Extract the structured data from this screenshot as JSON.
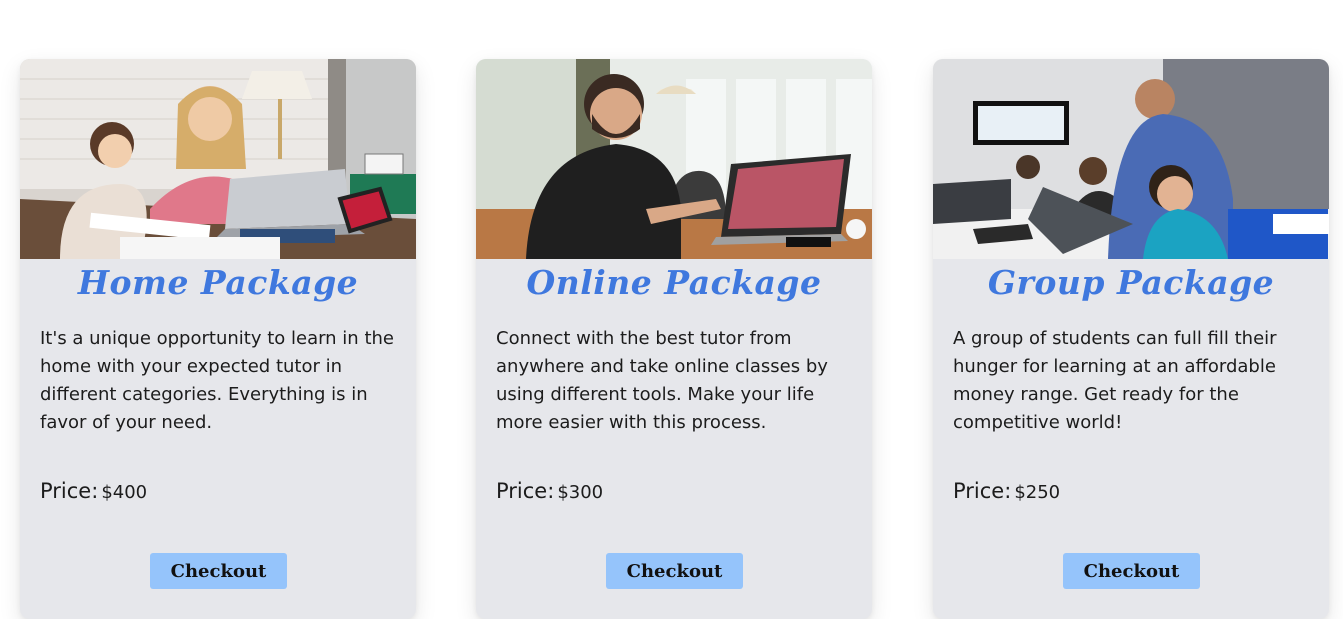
{
  "packages": [
    {
      "image_alt": "Mother and daughter learning at home with a laptop",
      "title": "Home Package",
      "description": "It's a unique opportunity to learn in the home with your expected tutor in different categories. Everything is in favor of your need.",
      "price_label": "Price:",
      "price_value": "$400",
      "button_label": "Checkout"
    },
    {
      "image_alt": "Smiling man taking an online class on a laptop",
      "title": "Online Package",
      "description": "Connect with the best tutor from anywhere and take online classes by using different tools. Make your life more easier with this process.",
      "price_label": "Price:",
      "price_value": "$300",
      "button_label": "Checkout"
    },
    {
      "image_alt": "Tutor helping a group of children at laptops",
      "title": "Group Package",
      "description": "A group of students can full fill their hunger for learning at an affordable money range. Get ready for the competitive world!",
      "price_label": "Price:",
      "price_value": "$250",
      "button_label": "Checkout"
    }
  ],
  "colors": {
    "card_background": "#e6e7eb",
    "title": "#3f78de",
    "button": "#95c4fb",
    "text": "#1c1c1c"
  }
}
